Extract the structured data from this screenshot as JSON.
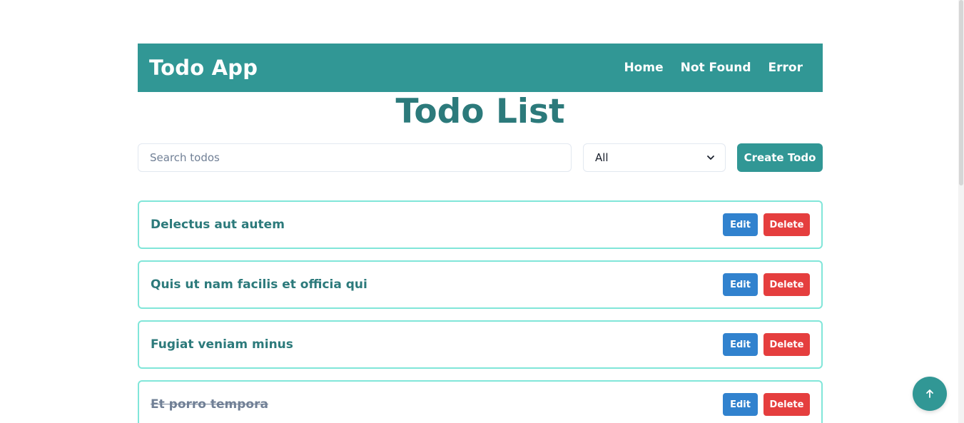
{
  "navbar": {
    "brand": "Todo App",
    "links": [
      "Home",
      "Not Found",
      "Error"
    ]
  },
  "page": {
    "title": "Todo List"
  },
  "controls": {
    "search_placeholder": "Search todos",
    "search_value": "",
    "filter_selected": "All",
    "create_label": "Create Todo"
  },
  "todos": [
    {
      "title": "Delectus aut autem",
      "completed": false,
      "edit_label": "Edit",
      "delete_label": "Delete"
    },
    {
      "title": "Quis ut nam facilis et officia qui",
      "completed": false,
      "edit_label": "Edit",
      "delete_label": "Delete"
    },
    {
      "title": "Fugiat veniam minus",
      "completed": false,
      "edit_label": "Edit",
      "delete_label": "Delete"
    },
    {
      "title": "Et porro tempora",
      "completed": true,
      "edit_label": "Edit",
      "delete_label": "Delete"
    }
  ],
  "icons": {
    "filter_dropdown": "chevron-down-icon",
    "scroll_top": "arrow-up-icon"
  },
  "colors": {
    "primary": "#319795",
    "title": "#2c7a7b",
    "item_border": "#81e6d9",
    "edit": "#3182ce",
    "delete": "#e53e3e"
  }
}
